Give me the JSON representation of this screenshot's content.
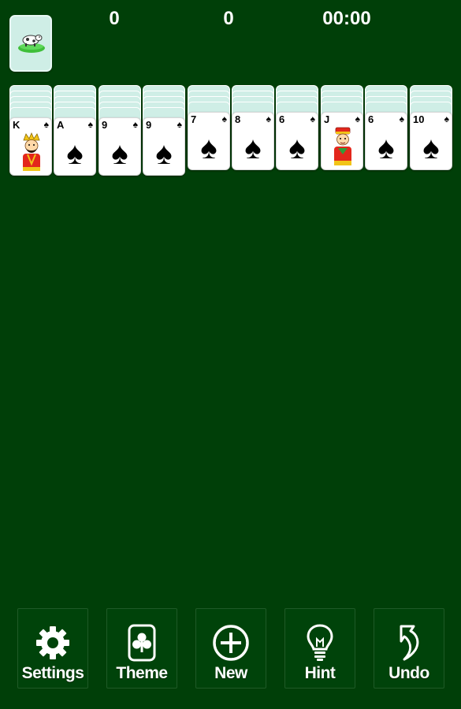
{
  "header": {
    "score": "0",
    "moves": "0",
    "time": "00:00"
  },
  "stock": {
    "icon": "cow-on-grass-icon"
  },
  "colors": {
    "felt": "#003f08",
    "card_back": "#cfeee6",
    "card_face": "#ffffff"
  },
  "tableau": [
    {
      "face_down": 5,
      "top_card": {
        "rank": "K",
        "suit": "♠",
        "figure": "king"
      }
    },
    {
      "face_down": 5,
      "top_card": {
        "rank": "A",
        "suit": "♠"
      }
    },
    {
      "face_down": 5,
      "top_card": {
        "rank": "9",
        "suit": "♠"
      }
    },
    {
      "face_down": 5,
      "top_card": {
        "rank": "9",
        "suit": "♠"
      }
    },
    {
      "face_down": 4,
      "top_card": {
        "rank": "7",
        "suit": "♠"
      }
    },
    {
      "face_down": 4,
      "top_card": {
        "rank": "8",
        "suit": "♠"
      }
    },
    {
      "face_down": 4,
      "top_card": {
        "rank": "6",
        "suit": "♠"
      }
    },
    {
      "face_down": 4,
      "top_card": {
        "rank": "J",
        "suit": "♠",
        "figure": "jack"
      }
    },
    {
      "face_down": 4,
      "top_card": {
        "rank": "6",
        "suit": "♠"
      }
    },
    {
      "face_down": 4,
      "top_card": {
        "rank": "10",
        "suit": "♠"
      }
    }
  ],
  "toolbar": {
    "settings": {
      "label": "Settings",
      "icon": "gear-icon"
    },
    "theme": {
      "label": "Theme",
      "icon": "club-card-icon"
    },
    "new": {
      "label": "New",
      "icon": "plus-circle-icon"
    },
    "hint": {
      "label": "Hint",
      "icon": "lightbulb-icon"
    },
    "undo": {
      "label": "Undo",
      "icon": "undo-arrow-icon"
    }
  }
}
